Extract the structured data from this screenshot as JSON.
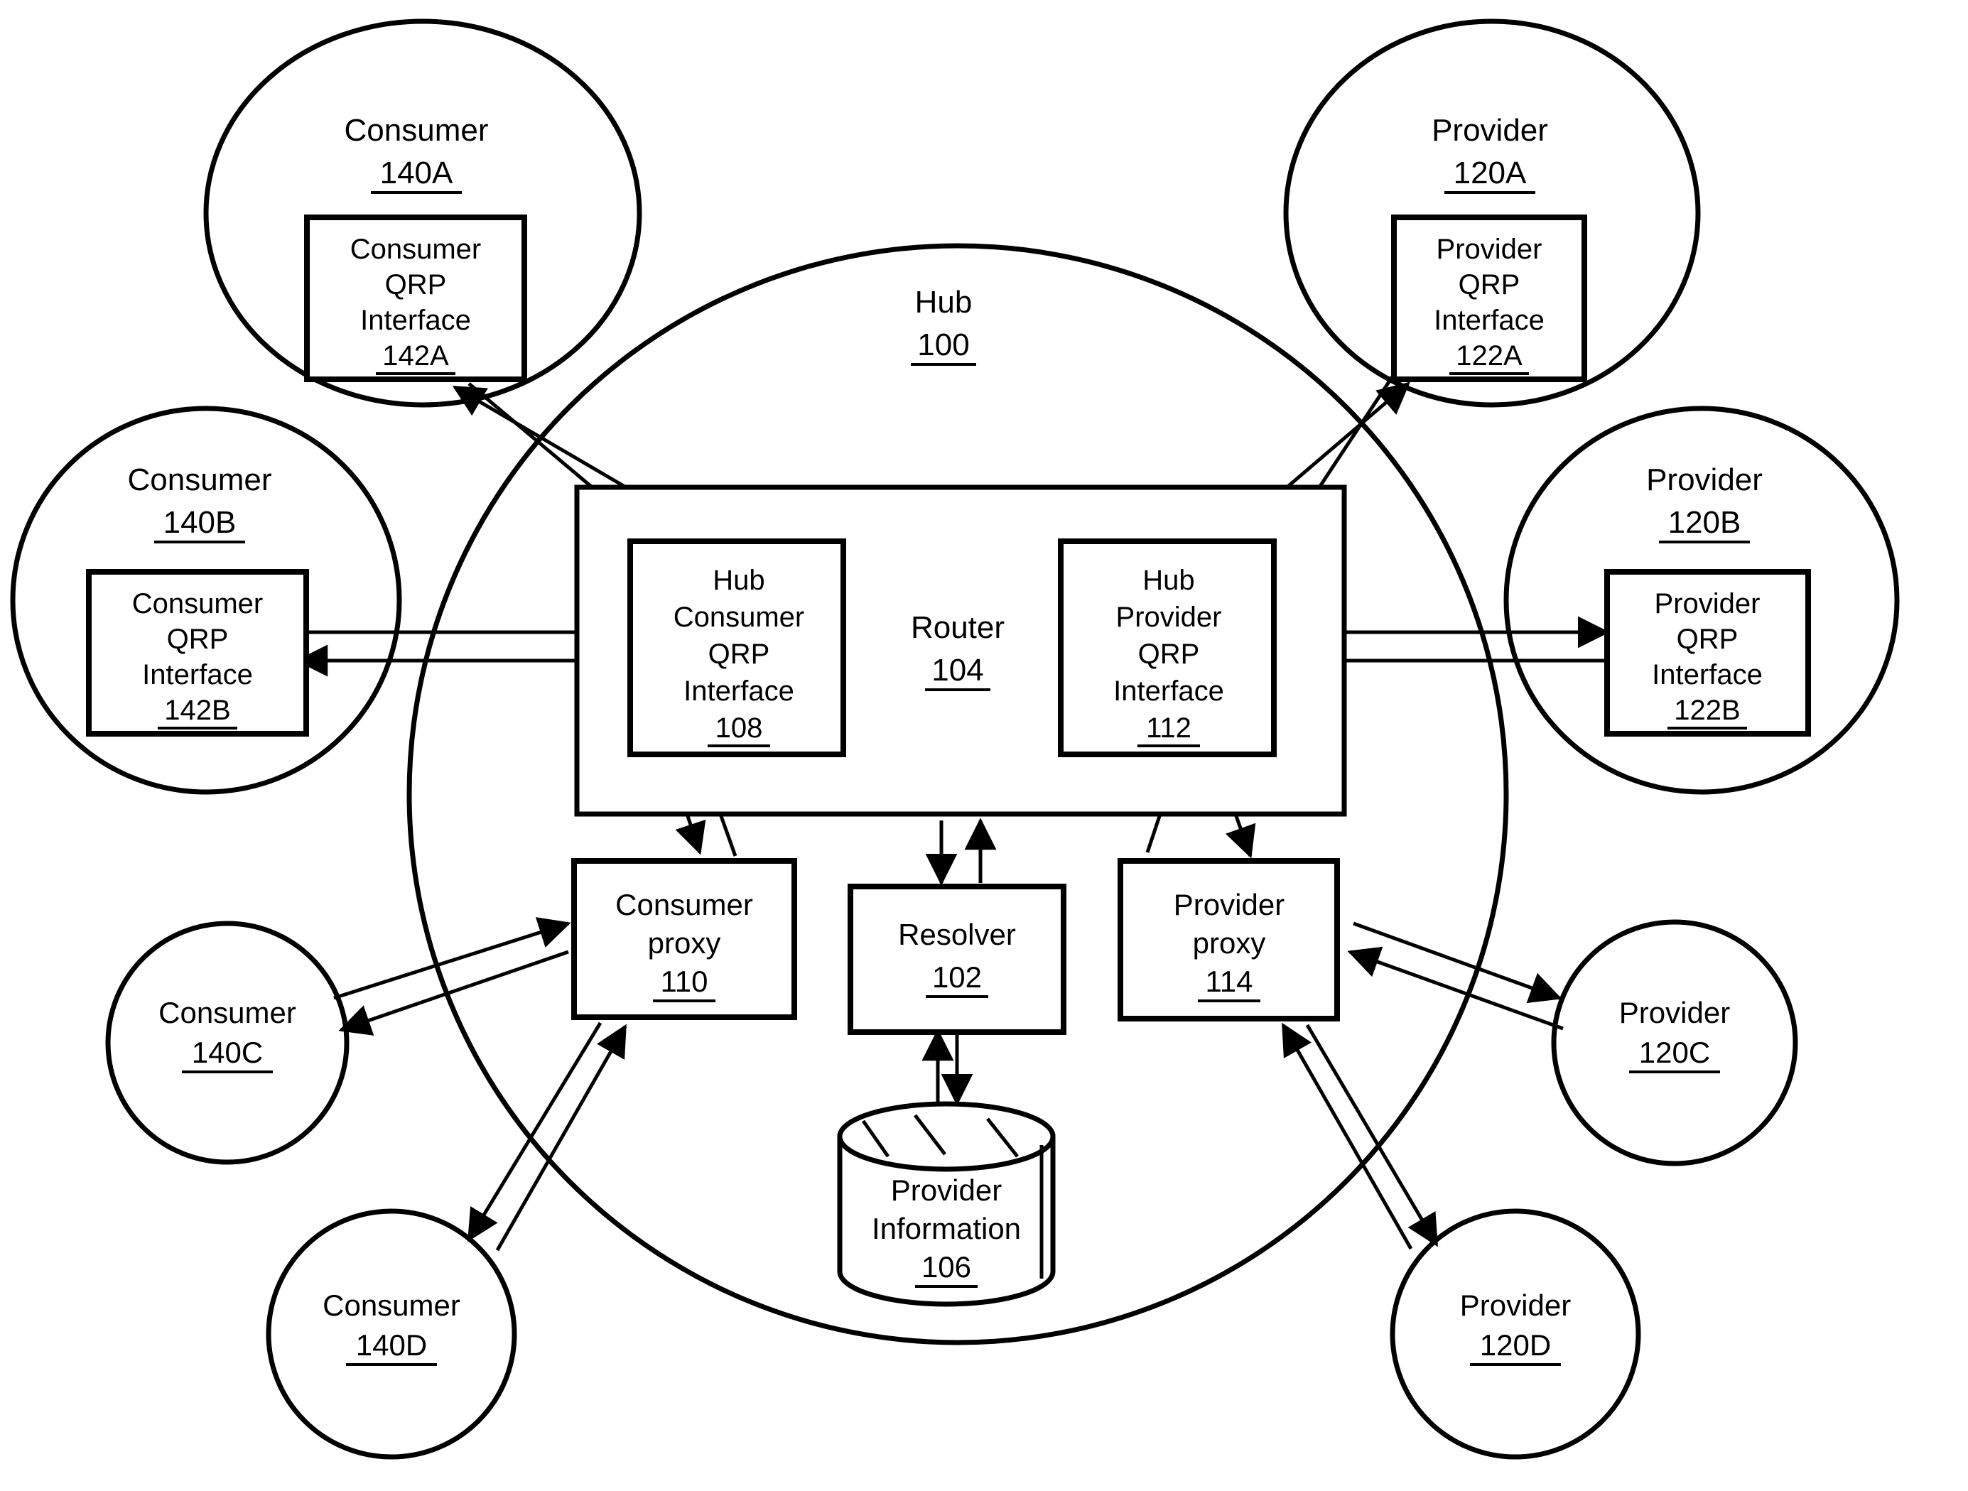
{
  "figure": {
    "type": "patent-block-diagram",
    "title_visible": false,
    "ink_color": "#000000",
    "background_color": "#ffffff"
  },
  "hub": {
    "label": "Hub",
    "ref": "100",
    "router": {
      "label": "Router",
      "ref": "104"
    },
    "hub_consumer_qrp_interface": {
      "line1": "Hub",
      "line2": "Consumer",
      "line3": "QRP",
      "line4": "Interface",
      "ref": "108"
    },
    "hub_provider_qrp_interface": {
      "line1": "Hub",
      "line2": "Provider",
      "line3": "QRP",
      "line4": "Interface",
      "ref": "112"
    },
    "consumer_proxy": {
      "line1": "Consumer",
      "line2": "proxy",
      "ref": "110"
    },
    "resolver": {
      "line1": "Resolver",
      "ref": "102"
    },
    "provider_proxy": {
      "line1": "Provider",
      "line2": "proxy",
      "ref": "114"
    },
    "provider_information_store": {
      "line1": "Provider",
      "line2": "Information",
      "ref": "106",
      "shape": "database-cylinder"
    }
  },
  "consumers": [
    {
      "id": "A",
      "label": "Consumer",
      "ref": "140A",
      "interface": {
        "line1": "Consumer",
        "line2": "QRP",
        "line3": "Interface",
        "ref": "142A"
      }
    },
    {
      "id": "B",
      "label": "Consumer",
      "ref": "140B",
      "interface": {
        "line1": "Consumer",
        "line2": "QRP",
        "line3": "Interface",
        "ref": "142B"
      }
    },
    {
      "id": "C",
      "label": "Consumer",
      "ref": "140C",
      "interface": null
    },
    {
      "id": "D",
      "label": "Consumer",
      "ref": "140D",
      "interface": null
    }
  ],
  "providers": [
    {
      "id": "A",
      "label": "Provider",
      "ref": "120A",
      "interface": {
        "line1": "Provider",
        "line2": "QRP",
        "line3": "Interface",
        "ref": "122A"
      }
    },
    {
      "id": "B",
      "label": "Provider",
      "ref": "120B",
      "interface": {
        "line1": "Provider",
        "line2": "QRP",
        "line3": "Interface",
        "ref": "122B"
      }
    },
    {
      "id": "C",
      "label": "Provider",
      "ref": "120C",
      "interface": null
    },
    {
      "id": "D",
      "label": "Provider",
      "ref": "120D",
      "interface": null
    }
  ]
}
